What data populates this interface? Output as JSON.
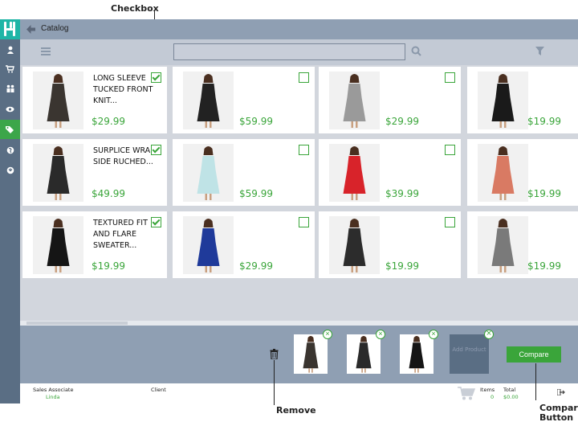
{
  "annotations": {
    "checkbox": "Checkbox",
    "remove": "Remove",
    "compare_line1": "Compare",
    "compare_line2": "Button"
  },
  "topbar": {
    "title": "Catalog"
  },
  "products": [
    {
      "name": "LONG SLEEVE TUCKED FRONT KNIT...",
      "price": "$29.99",
      "checked": true,
      "dress_color": "#3a3530"
    },
    {
      "name": "",
      "price": "$59.99",
      "checked": false,
      "dress_color": "#222222"
    },
    {
      "name": "",
      "price": "$29.99",
      "checked": false,
      "dress_color": "#9a9a9a"
    },
    {
      "name": "",
      "price": "$19.99",
      "checked": false,
      "dress_color": "#1a1a1a"
    },
    {
      "name": "SURPLICE WRAP SIDE RUCHED...",
      "price": "$49.99",
      "checked": true,
      "dress_color": "#2a2a2a"
    },
    {
      "name": "",
      "price": "$59.99",
      "checked": false,
      "dress_color": "#bfe3e6"
    },
    {
      "name": "",
      "price": "$39.99",
      "checked": false,
      "dress_color": "#d8232a"
    },
    {
      "name": "",
      "price": "$19.99",
      "checked": false,
      "dress_color": "#d97a63"
    },
    {
      "name": "TEXTURED FIT AND FLARE SWEATER...",
      "price": "$19.99",
      "checked": true,
      "dress_color": "#151515"
    },
    {
      "name": "",
      "price": "$29.99",
      "checked": false,
      "dress_color": "#1f3a9a"
    },
    {
      "name": "",
      "price": "$19.99",
      "checked": false,
      "dress_color": "#2c2c2c"
    },
    {
      "name": "",
      "price": "$19.99",
      "checked": false,
      "dress_color": "#7a7a7a"
    }
  ],
  "tray": {
    "add_product_label": "Add Product",
    "compare_label": "Compare"
  },
  "status": {
    "associate_label": "Sales Associate",
    "associate_name": "Linda",
    "client_label": "Client",
    "items_label": "Items",
    "items_value": "0",
    "total_label": "Total",
    "total_value": "$0.00"
  },
  "colors": {
    "accent": "#3aa53a",
    "sidebar": "#5a6e84",
    "topbar": "#8f9fb3",
    "logo": "#1fb5a6"
  },
  "icons": [
    "back-arrow-icon",
    "menu-icon",
    "search-icon",
    "filter-icon",
    "user-icon",
    "cart-icon",
    "people-icon",
    "eye-icon",
    "tags-icon",
    "globe-icon",
    "power-icon",
    "trash-icon",
    "logout-icon"
  ]
}
